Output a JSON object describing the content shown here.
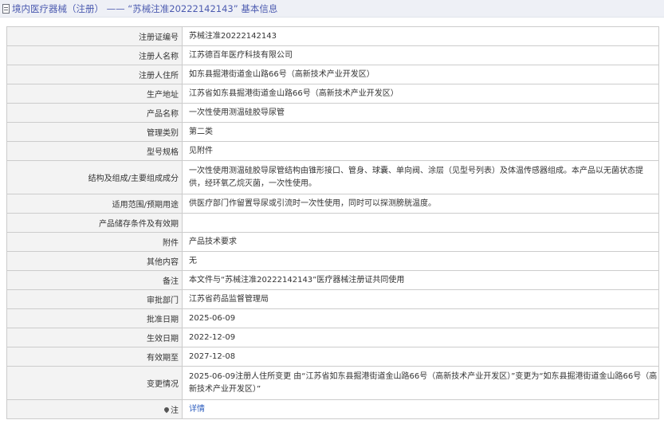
{
  "header": {
    "title": "境内医疗器械（注册） —— “苏械注准20222142143” 基本信息"
  },
  "rows": [
    {
      "label": "注册证编号",
      "value": "苏械注准20222142143"
    },
    {
      "label": "注册人名称",
      "value": "江苏德百年医疗科技有限公司"
    },
    {
      "label": "注册人住所",
      "value": "如东县掘港街道金山路66号（高新技术产业开发区）"
    },
    {
      "label": "生产地址",
      "value": "江苏省如东县掘港街道金山路66号（高新技术产业开发区）"
    },
    {
      "label": "产品名称",
      "value": "一次性使用测温硅胶导尿管"
    },
    {
      "label": "管理类别",
      "value": "第二类"
    },
    {
      "label": "型号规格",
      "value": "见附件"
    },
    {
      "label": "结构及组成/主要组成成分",
      "value": "一次性使用测温硅胶导尿管结构由锥形接口、管身、球囊、单向阀、涂层（见型号列表）及体温传感器组成。本产品以无菌状态提供，经环氧乙烷灭菌，一次性使用。"
    },
    {
      "label": "适用范围/预期用途",
      "value": "供医疗部门作留置导尿或引流时一次性使用，同时可以探测膀胱温度。"
    },
    {
      "label": "产品储存条件及有效期",
      "value": ""
    },
    {
      "label": "附件",
      "value": "产品技术要求"
    },
    {
      "label": "其他内容",
      "value": "无"
    },
    {
      "label": "备注",
      "value": "本文件与“苏械注准20222142143”医疗器械注册证共同使用"
    },
    {
      "label": "审批部门",
      "value": "江苏省药品监督管理局"
    },
    {
      "label": "批准日期",
      "value": "2025-06-09"
    },
    {
      "label": "生效日期",
      "value": "2022-12-09"
    },
    {
      "label": "有效期至",
      "value": "2027-12-08"
    },
    {
      "label": "变更情况",
      "value": "2025-06-09注册人住所变更 由“江苏省如东县掘港街道金山路66号（高新技术产业开发区）”变更为“如东县掘港街道金山路66号（高新技术产业开发区）”"
    }
  ],
  "note": {
    "label": "注",
    "link": "详情"
  }
}
